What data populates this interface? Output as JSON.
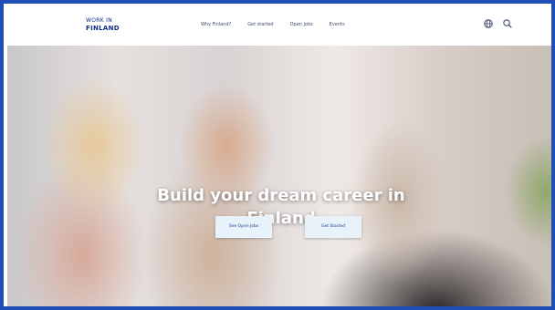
{
  "header": {
    "logo_line1": "WORK IN",
    "logo_line2": "FINLAND",
    "nav": [
      {
        "label": "Why Finland?"
      },
      {
        "label": "Get started"
      },
      {
        "label": "Open jobs"
      },
      {
        "label": "Events"
      }
    ],
    "icons": [
      "language-globe-icon",
      "search-icon"
    ]
  },
  "hero": {
    "title": "Build your dream career in Finland",
    "cta_primary": "See Open Jobs",
    "cta_secondary": "Get Started"
  },
  "colors": {
    "frame_border": "#1f4fb5",
    "brand_navy": "#0b2f84",
    "cta_bg": "#e8f2fb"
  }
}
